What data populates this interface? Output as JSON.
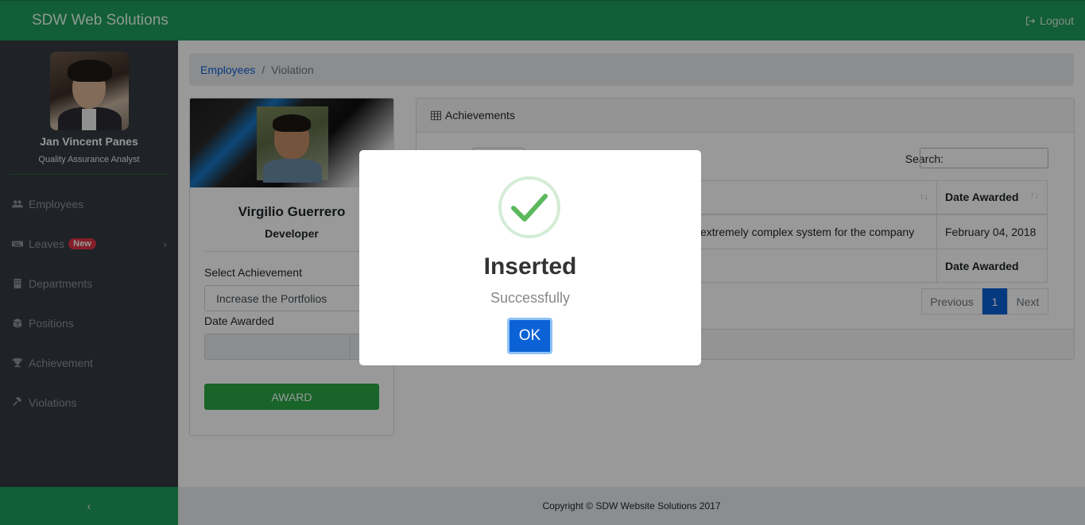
{
  "navbar": {
    "brand": "SDW Web Solutions",
    "logout_label": "Logout"
  },
  "sidebar": {
    "user_name": "Jan Vincent Panes",
    "user_role": "Quality Assurance Analyst",
    "items": [
      {
        "label": "Employees",
        "icon": "users-icon"
      },
      {
        "label": "Leaves",
        "icon": "keyboard-icon",
        "badge": "New"
      },
      {
        "label": "Departments",
        "icon": "building-icon"
      },
      {
        "label": "Positions",
        "icon": "cube-icon"
      },
      {
        "label": "Achievement",
        "icon": "trophy-icon"
      },
      {
        "label": "Violations",
        "icon": "gavel-icon"
      }
    ],
    "toggle": "‹"
  },
  "breadcrumb": {
    "link": "Employees",
    "separator": "/",
    "active": "Violation"
  },
  "employee": {
    "name": "Virgilio Guerrero",
    "position": "Developer",
    "select_label": "Select Achievement",
    "select_value": "Increase the Portfolios",
    "date_label": "Date Awarded",
    "award_button": "AWARD"
  },
  "achievements": {
    "header": "Achievements",
    "search_label": "Search:",
    "column_date": "Date Awarded",
    "sort_glyph": "↑↓",
    "rows": [
      {
        "description": "extremely complex system for the company",
        "date": "February 04, 2018"
      }
    ],
    "footer_date": "Date Awarded",
    "pagination": {
      "previous": "Previous",
      "current": "1",
      "next": "Next"
    }
  },
  "footer": {
    "copyright": "Copyright © SDW Website Solutions 2017"
  },
  "modal": {
    "title": "Inserted",
    "text": "Successfully",
    "ok_label": "OK"
  },
  "colors": {
    "primary_green": "#1e9d5a",
    "sidebar": "#343a40",
    "accent_blue": "#0b62d6",
    "success_green": "#28a745",
    "danger_red": "#dc3545"
  }
}
